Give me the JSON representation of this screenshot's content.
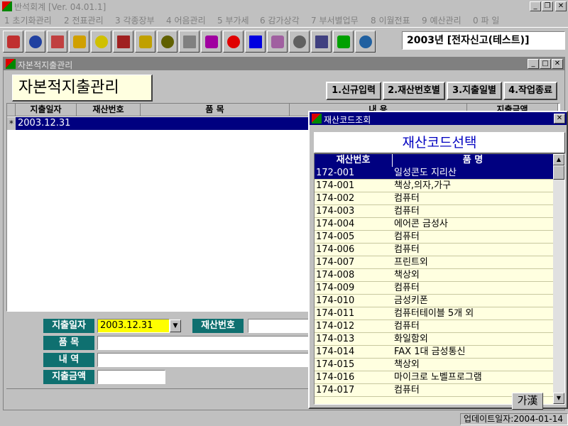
{
  "app": {
    "title": "반석회계 [Ver. 04.01.1]",
    "win_min": "_",
    "win_restore": "❐",
    "win_close": "✕"
  },
  "menu": [
    {
      "key": "1",
      "label": "초기화관리"
    },
    {
      "key": "2",
      "label": "전표관리"
    },
    {
      "key": "3",
      "label": "각종장부"
    },
    {
      "key": "4",
      "label": "어음관리"
    },
    {
      "key": "5",
      "label": "부가세"
    },
    {
      "key": "6",
      "label": "감가상각"
    },
    {
      "key": "7",
      "label": "부서별업무"
    },
    {
      "key": "8",
      "label": "이월전표"
    },
    {
      "key": "9",
      "label": "예산관리"
    },
    {
      "key": "0",
      "label": "파 일"
    }
  ],
  "toolbar": {
    "icons": [
      "exit-icon",
      "org-tree-icon",
      "globe-icon",
      "pencil-edit-icon",
      "tag-icon",
      "abacus-icon",
      "coin-icon",
      "book-icon",
      "scale-icon",
      "toolbox-icon",
      "arrow-up-red-icon",
      "arrow-up-blue-icon",
      "exchange-icon",
      "calculator-icon",
      "printer-icon",
      "refresh-icon",
      "report-icon"
    ],
    "colors": [
      "#c03030",
      "#2040a0",
      "#c04040",
      "#d0a000",
      "#d0c000",
      "#a02020",
      "#c0a000",
      "#606000",
      "#808080",
      "#a000a0",
      "#e00000",
      "#0000e0",
      "#a060a0",
      "#606060",
      "#404080",
      "#00a000",
      "#2060a0"
    ]
  },
  "company": "2003년 [전자신고(테스트)]",
  "child": {
    "title": "자본적지출관리",
    "min": "_",
    "max": "□",
    "close": "✕",
    "heading": "자본적지출관리",
    "buttons": [
      "1.신규입력",
      "2.재산번호별",
      "3.지출일별",
      "4.작업종료"
    ]
  },
  "grid": {
    "columns": [
      "지출일자",
      "재산번호",
      "품 목",
      "내 용",
      "지출금액"
    ],
    "row_marker": "*",
    "row_date": "2003.12.31"
  },
  "form": {
    "date_label": "지출일자",
    "date_value": "2003.12.31",
    "dropdown_arrow": "▼",
    "asset_label": "재산번호",
    "item_label": "품 목",
    "detail_label": "내 역",
    "amount_label": "지출금액"
  },
  "popup": {
    "title": "재산코드조회",
    "close": "✕",
    "heading": "재산코드선택",
    "col1": "재산번호",
    "col2": "품 명",
    "rows": [
      {
        "code": "172-001",
        "name": "일성콘도 지리산"
      },
      {
        "code": "174-001",
        "name": "책상,의자,가구"
      },
      {
        "code": "174-002",
        "name": "컴퓨터"
      },
      {
        "code": "174-003",
        "name": "컴퓨터"
      },
      {
        "code": "174-004",
        "name": "에어콘 금성사"
      },
      {
        "code": "174-005",
        "name": "컴퓨터"
      },
      {
        "code": "174-006",
        "name": "컴퓨터"
      },
      {
        "code": "174-007",
        "name": "프린트외"
      },
      {
        "code": "174-008",
        "name": "책상외"
      },
      {
        "code": "174-009",
        "name": "컴퓨터"
      },
      {
        "code": "174-010",
        "name": "금성키폰"
      },
      {
        "code": "174-011",
        "name": "컴퓨터테이블 5개 외"
      },
      {
        "code": "174-012",
        "name": "컴퓨터"
      },
      {
        "code": "174-013",
        "name": "화일함외"
      },
      {
        "code": "174-014",
        "name": "FAX 1대 금성통신"
      },
      {
        "code": "174-015",
        "name": "책상외"
      },
      {
        "code": "174-016",
        "name": "마이크로 노벨프로그램"
      },
      {
        "code": "174-017",
        "name": "컴퓨터"
      }
    ],
    "hanja_button": "가漢",
    "scroll_up": "▲",
    "scroll_down": "▼"
  },
  "status": {
    "update": "업데이트일자:2004-01-14"
  }
}
